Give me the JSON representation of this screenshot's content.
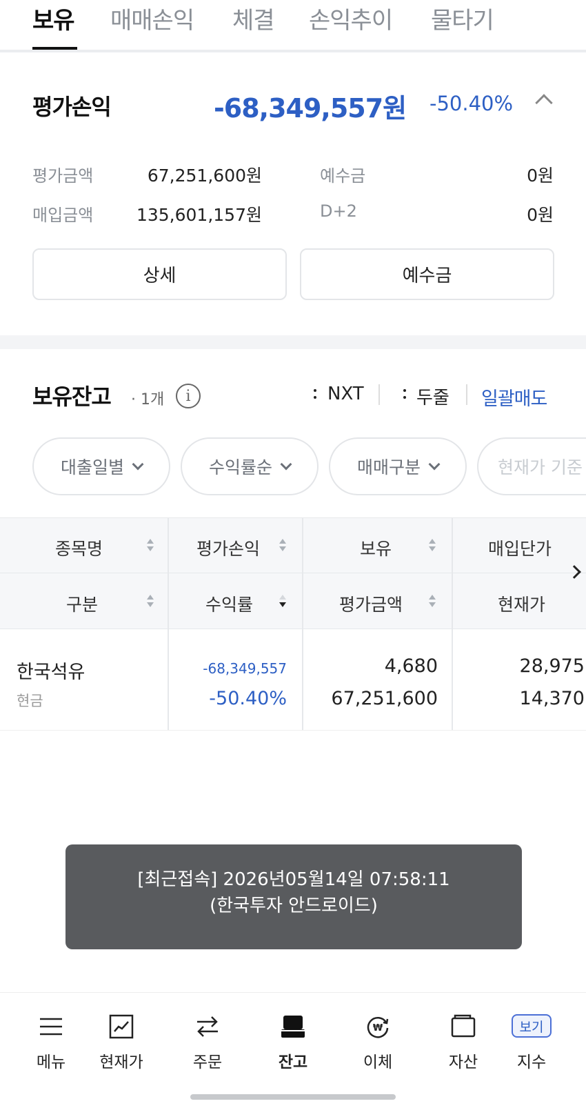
{
  "tabs": [
    "보유",
    "매매손익",
    "체결",
    "손익추이",
    "물타기"
  ],
  "summary": {
    "title": "평가손익",
    "amount": "-68,349,557원",
    "rate": "-50.40%",
    "rows": {
      "eval_amount_label": "평가금액",
      "eval_amount_value": "67,251,600원",
      "deposit_label": "예수금",
      "deposit_value": "0원",
      "purchase_label": "매입금액",
      "purchase_value": "135,601,157원",
      "d2_label": "D+2",
      "d2_value": "0원"
    },
    "detail_button": "상세",
    "deposit_button": "예수금"
  },
  "holdings": {
    "title": "보유잔고",
    "count": "· 1개",
    "info_icon": "i",
    "nxt_label": "NXT",
    "two_line_label": "두줄",
    "bulk_sell": "일괄매도",
    "filters": [
      "대출일별",
      "수익률순",
      "매매구분",
      "현재가 기준"
    ],
    "headers": {
      "row1": [
        "종목명",
        "평가손익",
        "보유",
        "매입단가"
      ],
      "row2": [
        "구분",
        "수익률",
        "평가금액",
        "현재가"
      ]
    },
    "rows": [
      {
        "name": "한국석유",
        "type": "현금",
        "pnl": "-68,349,557",
        "rate": "-50.40%",
        "qty": "4,680",
        "eval": "67,251,600",
        "avg_price": "28,975",
        "cur_price": "14,370"
      }
    ]
  },
  "toast": {
    "line1": "[최근접속] 2026년05월14일 07:58:11",
    "line2": "(한국투자 안드로이드)"
  },
  "bottom_nav": [
    "메뉴",
    "현재가",
    "주문",
    "잔고",
    "이체",
    "자산",
    "지수"
  ],
  "bogi_badge": "보기",
  "colors": {
    "accent_blue": "#2d5fc4",
    "toast_bg": "#595b5e"
  }
}
